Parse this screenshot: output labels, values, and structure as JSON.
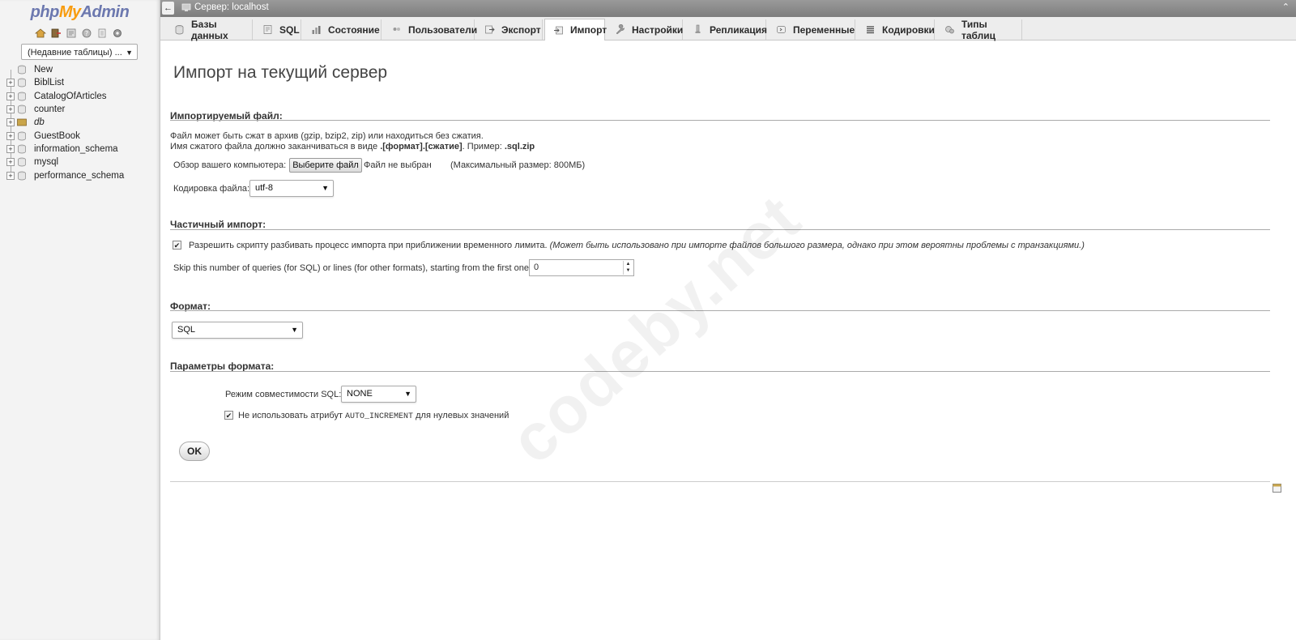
{
  "app": {
    "logo_php": "php",
    "logo_my": "My",
    "logo_admin": "Admin"
  },
  "sidebar": {
    "quick_icons": [
      "home-icon",
      "logout-icon",
      "query-window-icon",
      "docs-icon",
      "docs-page-icon",
      "settings-icon"
    ],
    "recent_tables": "(Недавние таблицы) ...",
    "databases": [
      {
        "name": "New",
        "type": "new"
      },
      {
        "name": "BiblList",
        "type": "db"
      },
      {
        "name": "CatalogOfArticles",
        "type": "db"
      },
      {
        "name": "counter",
        "type": "db"
      },
      {
        "name": "db",
        "type": "db-italic"
      },
      {
        "name": "GuestBook",
        "type": "db"
      },
      {
        "name": "information_schema",
        "type": "db"
      },
      {
        "name": "mysql",
        "type": "db"
      },
      {
        "name": "performance_schema",
        "type": "db"
      }
    ]
  },
  "topbar": {
    "back": "←",
    "server": "Сервер: localhost",
    "collapse": "⌃"
  },
  "tabs": [
    {
      "label": "Базы данных",
      "icon": "database-icon",
      "active": false
    },
    {
      "label": "SQL",
      "icon": "sql-icon",
      "active": false
    },
    {
      "label": "Состояние",
      "icon": "status-icon",
      "active": false
    },
    {
      "label": "Пользователи",
      "icon": "users-icon",
      "active": false
    },
    {
      "label": "Экспорт",
      "icon": "export-icon",
      "active": false
    },
    {
      "label": "Импорт",
      "icon": "import-icon",
      "active": true
    },
    {
      "label": "Настройки",
      "icon": "wrench-icon",
      "active": false
    },
    {
      "label": "Репликация",
      "icon": "replication-icon",
      "active": false
    },
    {
      "label": "Переменные",
      "icon": "variables-icon",
      "active": false
    },
    {
      "label": "Кодировки",
      "icon": "charset-icon",
      "active": false
    },
    {
      "label": "Типы таблиц",
      "icon": "engines-icon",
      "active": false
    }
  ],
  "main": {
    "title": "Импорт на текущий сервер",
    "file_section": {
      "title": "Импортируемый файл:",
      "note1": "Файл может быть сжат в архив (gzip, bzip2, zip) или находиться без сжатия.",
      "note2_prefix": "Имя сжатого файла должно заканчиваться в виде ",
      "note2_format": ".[формат].[сжатие]",
      "note2_mid": ". Пример: ",
      "note2_example": ".sql.zip",
      "browse_label": "Обзор вашего компьютера:",
      "choose_button": "Выберите файл",
      "no_file": "Файл не выбран",
      "max_size": "(Максимальный размер: 800МБ)",
      "charset_label": "Кодировка файла:",
      "charset_value": "utf-8"
    },
    "partial_section": {
      "title": "Частичный импорт:",
      "allow_interrupt": "Разрешить скрипту разбивать процесс импорта при приближении временного лимита.",
      "allow_interrupt_note": "(Может быть использовано при импорте файлов большого размера, однако при этом вероятны проблемы с транзакциями.)",
      "skip_label": "Skip this number of queries (for SQL) or lines (for other formats), starting from the first one:",
      "skip_value": "0"
    },
    "format_section": {
      "title": "Формат:",
      "value": "SQL"
    },
    "options_section": {
      "title": "Параметры формата:",
      "compat_label": "Режим совместимости SQL:",
      "compat_value": "NONE",
      "no_auto_prefix": "Не использовать атрибут ",
      "no_auto_code": "AUTO_INCREMENT",
      "no_auto_suffix": " для нулевых значений"
    },
    "ok_button": "OK"
  },
  "watermark": "codeby.net"
}
